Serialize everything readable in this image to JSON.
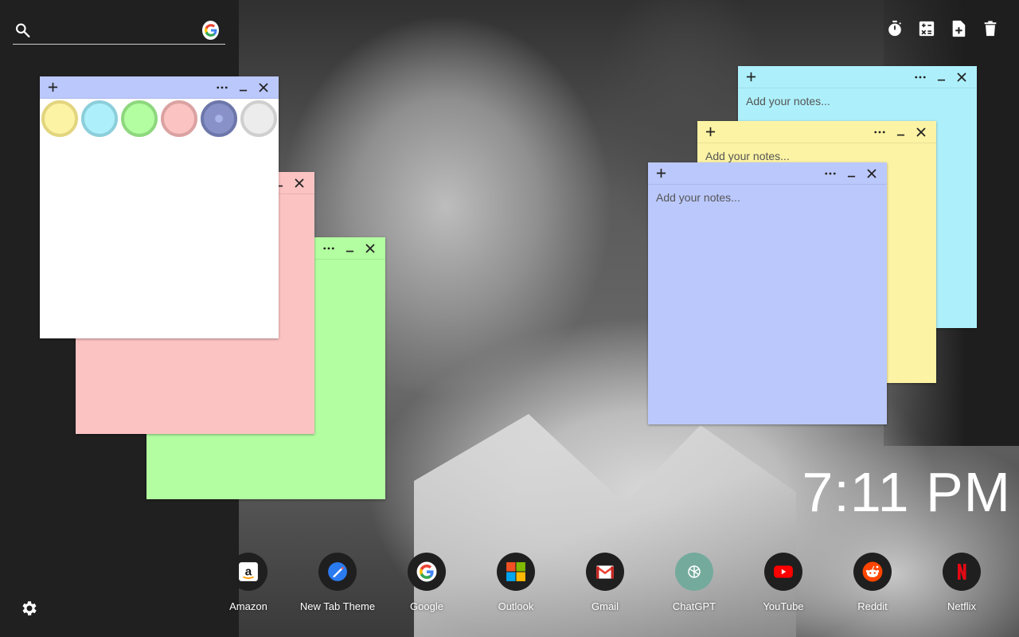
{
  "search": {
    "placeholder": "",
    "value": ""
  },
  "toolbar": {
    "items": [
      {
        "name": "timer",
        "icon": "timer-icon"
      },
      {
        "name": "calculator",
        "icon": "calculator-icon"
      },
      {
        "name": "new-note",
        "icon": "add-note-icon"
      },
      {
        "name": "delete",
        "icon": "trash-icon"
      }
    ]
  },
  "notes": {
    "placeholder": "Add your notes...",
    "add_label": "+",
    "more_label": "•••",
    "minimize_label": "_",
    "close_label": "✕"
  },
  "palette": {
    "swatches": [
      {
        "fill": "#fdf3a4",
        "border": "#e2d57e"
      },
      {
        "fill": "#adf0fb",
        "border": "#8ccfdb"
      },
      {
        "fill": "#b2fea0",
        "border": "#8ed77e"
      },
      {
        "fill": "#fcc3c3",
        "border": "#dba2a2"
      },
      {
        "fill": "#8892c8",
        "border": "#6d77aa",
        "selected": true
      },
      {
        "fill": "#ececec",
        "border": "#cfcfcf"
      }
    ]
  },
  "clock": {
    "time": "7:11 PM"
  },
  "shortcuts": [
    {
      "label": "Amazon",
      "icon": "amazon-icon"
    },
    {
      "label": "New Tab Theme",
      "icon": "new-tab-theme-icon"
    },
    {
      "label": "Google",
      "icon": "google-icon"
    },
    {
      "label": "Outlook",
      "icon": "microsoft-icon"
    },
    {
      "label": "Gmail",
      "icon": "gmail-icon"
    },
    {
      "label": "ChatGPT",
      "icon": "chatgpt-icon"
    },
    {
      "label": "YouTube",
      "icon": "youtube-icon"
    },
    {
      "label": "Reddit",
      "icon": "reddit-icon"
    },
    {
      "label": "Netflix",
      "icon": "netflix-icon"
    }
  ],
  "colors": {
    "note_cyan": "#adf0fb",
    "note_yellow": "#fdf3a4",
    "note_blue": "#bbc8fc",
    "note_green": "#b2fea0",
    "note_pink": "#fcc3c3",
    "note_white": "#ffffff"
  }
}
